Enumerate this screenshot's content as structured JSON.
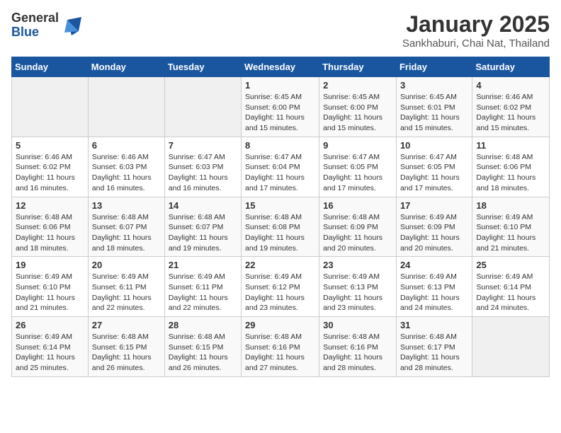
{
  "logo": {
    "general": "General",
    "blue": "Blue"
  },
  "header": {
    "month": "January 2025",
    "location": "Sankhaburi, Chai Nat, Thailand"
  },
  "weekdays": [
    "Sunday",
    "Monday",
    "Tuesday",
    "Wednesday",
    "Thursday",
    "Friday",
    "Saturday"
  ],
  "weeks": [
    [
      {
        "day": "",
        "info": ""
      },
      {
        "day": "",
        "info": ""
      },
      {
        "day": "",
        "info": ""
      },
      {
        "day": "1",
        "info": "Sunrise: 6:45 AM\nSunset: 6:00 PM\nDaylight: 11 hours\nand 15 minutes."
      },
      {
        "day": "2",
        "info": "Sunrise: 6:45 AM\nSunset: 6:00 PM\nDaylight: 11 hours\nand 15 minutes."
      },
      {
        "day": "3",
        "info": "Sunrise: 6:45 AM\nSunset: 6:01 PM\nDaylight: 11 hours\nand 15 minutes."
      },
      {
        "day": "4",
        "info": "Sunrise: 6:46 AM\nSunset: 6:02 PM\nDaylight: 11 hours\nand 15 minutes."
      }
    ],
    [
      {
        "day": "5",
        "info": "Sunrise: 6:46 AM\nSunset: 6:02 PM\nDaylight: 11 hours\nand 16 minutes."
      },
      {
        "day": "6",
        "info": "Sunrise: 6:46 AM\nSunset: 6:03 PM\nDaylight: 11 hours\nand 16 minutes."
      },
      {
        "day": "7",
        "info": "Sunrise: 6:47 AM\nSunset: 6:03 PM\nDaylight: 11 hours\nand 16 minutes."
      },
      {
        "day": "8",
        "info": "Sunrise: 6:47 AM\nSunset: 6:04 PM\nDaylight: 11 hours\nand 17 minutes."
      },
      {
        "day": "9",
        "info": "Sunrise: 6:47 AM\nSunset: 6:05 PM\nDaylight: 11 hours\nand 17 minutes."
      },
      {
        "day": "10",
        "info": "Sunrise: 6:47 AM\nSunset: 6:05 PM\nDaylight: 11 hours\nand 17 minutes."
      },
      {
        "day": "11",
        "info": "Sunrise: 6:48 AM\nSunset: 6:06 PM\nDaylight: 11 hours\nand 18 minutes."
      }
    ],
    [
      {
        "day": "12",
        "info": "Sunrise: 6:48 AM\nSunset: 6:06 PM\nDaylight: 11 hours\nand 18 minutes."
      },
      {
        "day": "13",
        "info": "Sunrise: 6:48 AM\nSunset: 6:07 PM\nDaylight: 11 hours\nand 18 minutes."
      },
      {
        "day": "14",
        "info": "Sunrise: 6:48 AM\nSunset: 6:07 PM\nDaylight: 11 hours\nand 19 minutes."
      },
      {
        "day": "15",
        "info": "Sunrise: 6:48 AM\nSunset: 6:08 PM\nDaylight: 11 hours\nand 19 minutes."
      },
      {
        "day": "16",
        "info": "Sunrise: 6:48 AM\nSunset: 6:09 PM\nDaylight: 11 hours\nand 20 minutes."
      },
      {
        "day": "17",
        "info": "Sunrise: 6:49 AM\nSunset: 6:09 PM\nDaylight: 11 hours\nand 20 minutes."
      },
      {
        "day": "18",
        "info": "Sunrise: 6:49 AM\nSunset: 6:10 PM\nDaylight: 11 hours\nand 21 minutes."
      }
    ],
    [
      {
        "day": "19",
        "info": "Sunrise: 6:49 AM\nSunset: 6:10 PM\nDaylight: 11 hours\nand 21 minutes."
      },
      {
        "day": "20",
        "info": "Sunrise: 6:49 AM\nSunset: 6:11 PM\nDaylight: 11 hours\nand 22 minutes."
      },
      {
        "day": "21",
        "info": "Sunrise: 6:49 AM\nSunset: 6:11 PM\nDaylight: 11 hours\nand 22 minutes."
      },
      {
        "day": "22",
        "info": "Sunrise: 6:49 AM\nSunset: 6:12 PM\nDaylight: 11 hours\nand 23 minutes."
      },
      {
        "day": "23",
        "info": "Sunrise: 6:49 AM\nSunset: 6:13 PM\nDaylight: 11 hours\nand 23 minutes."
      },
      {
        "day": "24",
        "info": "Sunrise: 6:49 AM\nSunset: 6:13 PM\nDaylight: 11 hours\nand 24 minutes."
      },
      {
        "day": "25",
        "info": "Sunrise: 6:49 AM\nSunset: 6:14 PM\nDaylight: 11 hours\nand 24 minutes."
      }
    ],
    [
      {
        "day": "26",
        "info": "Sunrise: 6:49 AM\nSunset: 6:14 PM\nDaylight: 11 hours\nand 25 minutes."
      },
      {
        "day": "27",
        "info": "Sunrise: 6:48 AM\nSunset: 6:15 PM\nDaylight: 11 hours\nand 26 minutes."
      },
      {
        "day": "28",
        "info": "Sunrise: 6:48 AM\nSunset: 6:15 PM\nDaylight: 11 hours\nand 26 minutes."
      },
      {
        "day": "29",
        "info": "Sunrise: 6:48 AM\nSunset: 6:16 PM\nDaylight: 11 hours\nand 27 minutes."
      },
      {
        "day": "30",
        "info": "Sunrise: 6:48 AM\nSunset: 6:16 PM\nDaylight: 11 hours\nand 28 minutes."
      },
      {
        "day": "31",
        "info": "Sunrise: 6:48 AM\nSunset: 6:17 PM\nDaylight: 11 hours\nand 28 minutes."
      },
      {
        "day": "",
        "info": ""
      }
    ]
  ]
}
